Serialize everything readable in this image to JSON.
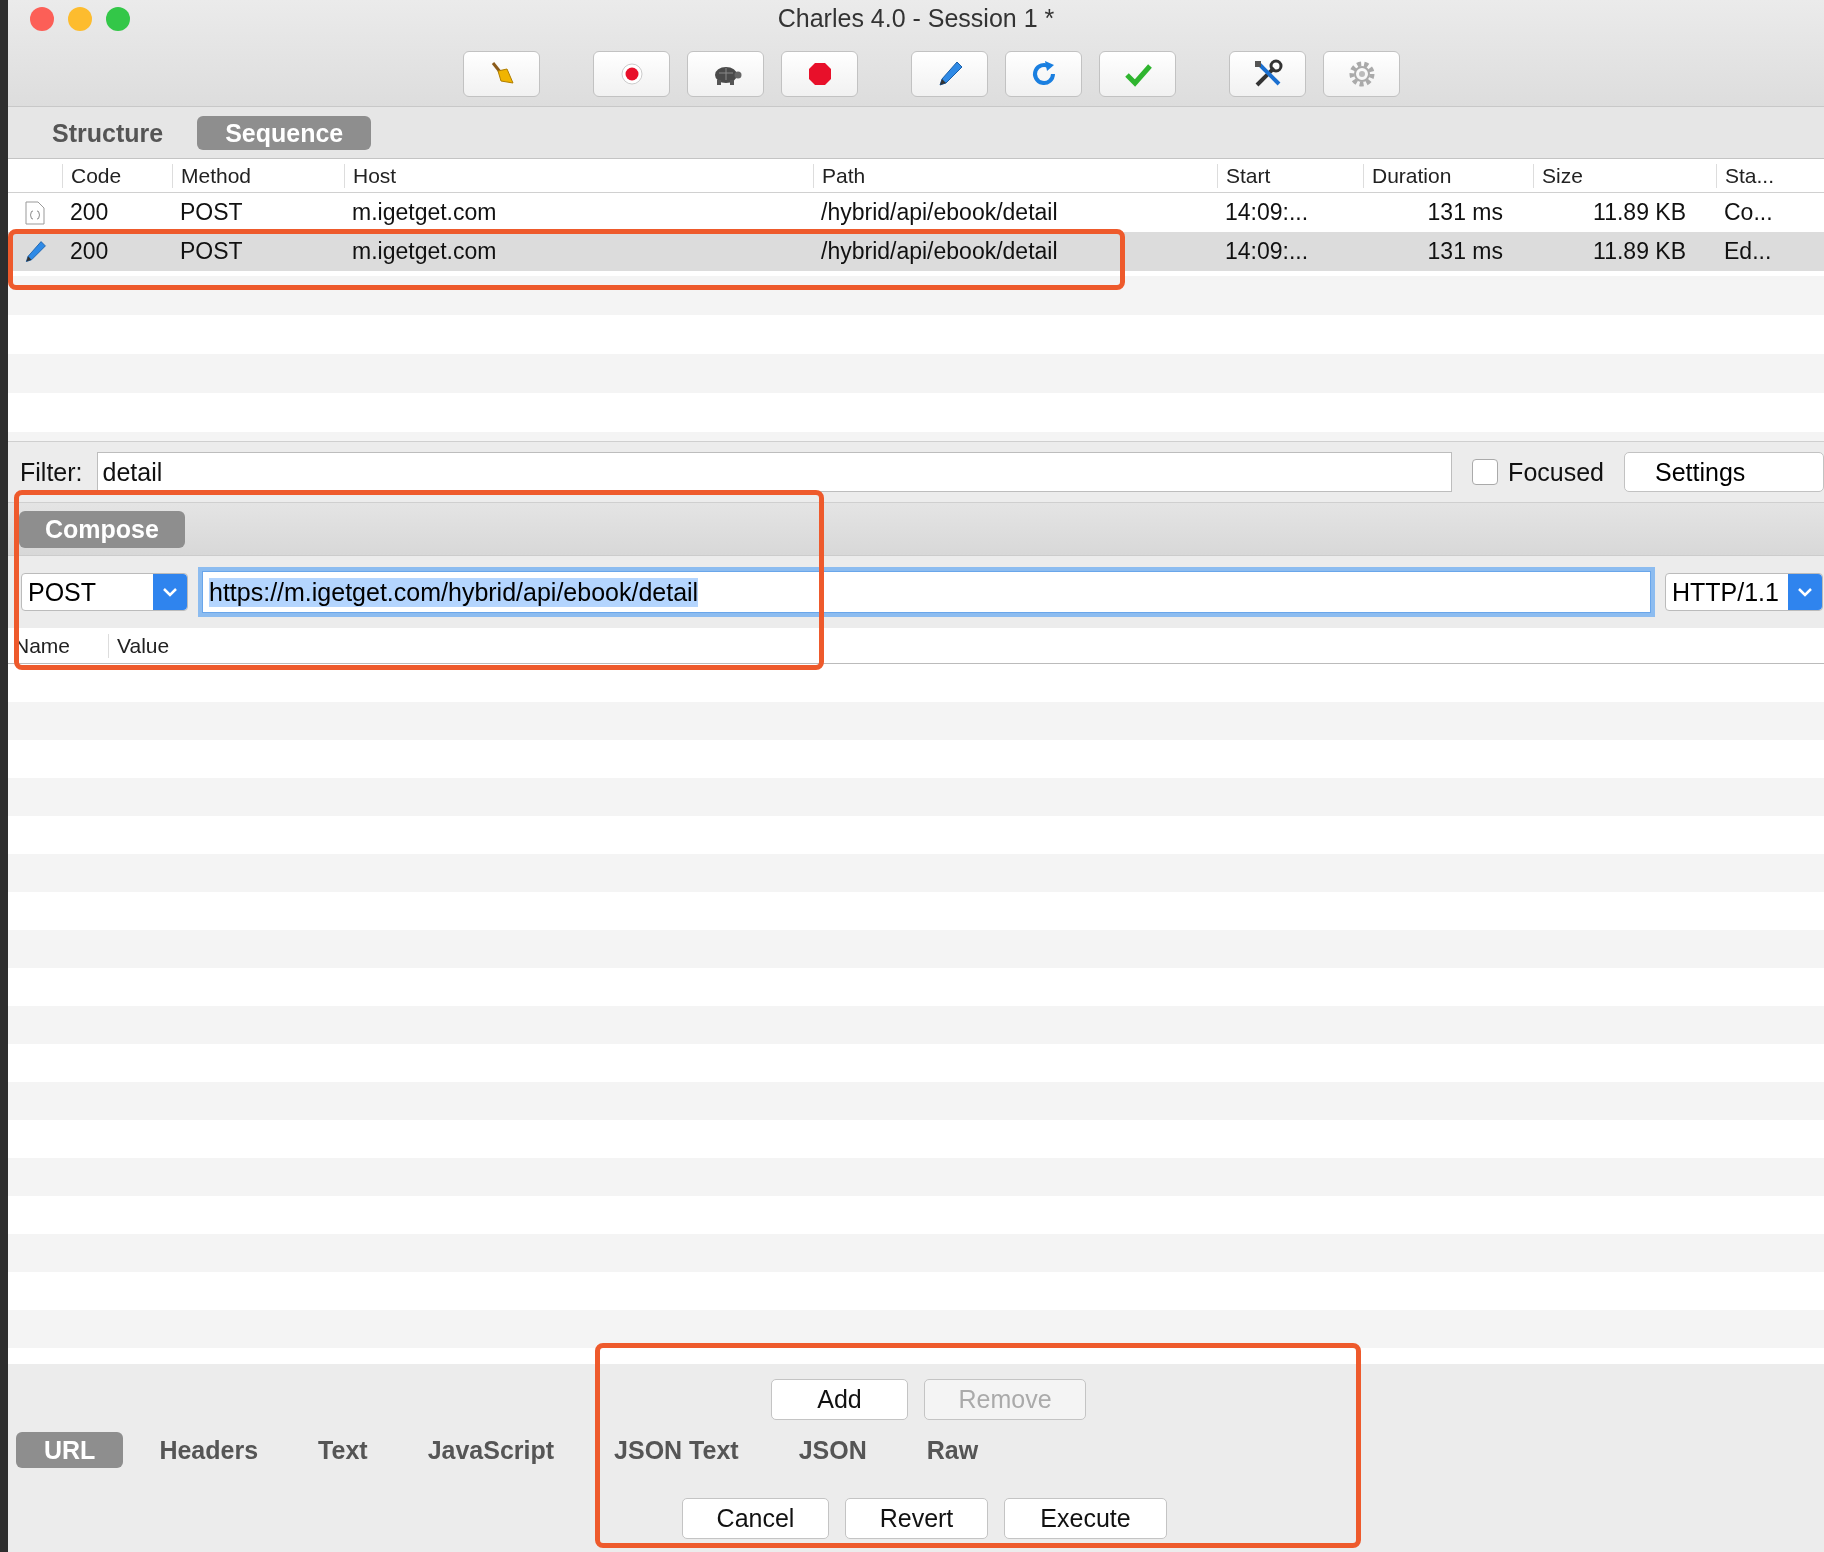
{
  "window": {
    "title": "Charles 4.0 - Session 1 *"
  },
  "view_tabs": [
    {
      "label": "Structure",
      "selected": false
    },
    {
      "label": "Sequence",
      "selected": true
    }
  ],
  "table": {
    "columns": [
      "Code",
      "Method",
      "Host",
      "Path",
      "Start",
      "Duration",
      "Size",
      "Sta..."
    ],
    "rows": [
      {
        "kind": "response",
        "selected": false,
        "cells": [
          "200",
          "POST",
          "m.igetget.com",
          "/hybrid/api/ebook/detail",
          "14:09:...",
          "131 ms",
          "11.89 KB",
          "Co..."
        ]
      },
      {
        "kind": "composed",
        "selected": true,
        "cells": [
          "200",
          "POST",
          "m.igetget.com",
          "/hybrid/api/ebook/detail",
          "14:09:...",
          "131 ms",
          "11.89 KB",
          "Ed..."
        ]
      }
    ]
  },
  "filter": {
    "label": "Filter:",
    "value": "detail",
    "focused_checkbox": {
      "label": "Focused",
      "checked": false
    },
    "settings_button": "Settings"
  },
  "compose": {
    "tab": {
      "label": "Compose",
      "selected": true
    },
    "method": "POST",
    "url": {
      "value": "https://m.igetget.com/hybrid/api/ebook/detail",
      "focused": true
    },
    "protocol": "HTTP/1.1",
    "columns": [
      "Name",
      "Value"
    ]
  },
  "param_buttons": [
    {
      "label": "Add",
      "disabled": false
    },
    {
      "label": "Remove",
      "disabled": true
    }
  ],
  "body_tabs": [
    {
      "label": "URL",
      "selected": true
    },
    {
      "label": "Headers",
      "selected": false
    },
    {
      "label": "Text",
      "selected": false
    },
    {
      "label": "JavaScript",
      "selected": false
    },
    {
      "label": "JSON Text",
      "selected": false
    },
    {
      "label": "JSON",
      "selected": false
    },
    {
      "label": "Raw",
      "selected": false
    }
  ],
  "action_buttons": [
    {
      "label": "Cancel",
      "disabled": false
    },
    {
      "label": "Revert",
      "disabled": false
    },
    {
      "label": "Execute",
      "disabled": false
    }
  ]
}
